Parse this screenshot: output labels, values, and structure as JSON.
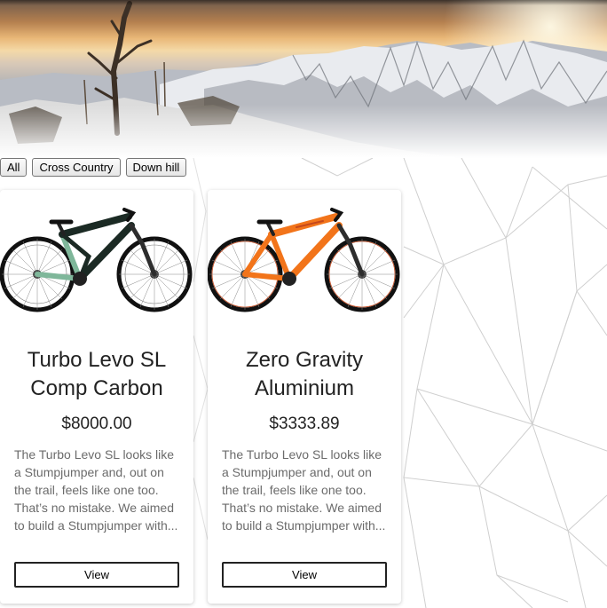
{
  "filters": [
    {
      "label": "All"
    },
    {
      "label": "Cross Country"
    },
    {
      "label": "Down hill"
    }
  ],
  "products": [
    {
      "title": "Turbo Levo SL Comp Carbon",
      "price": "$8000.00",
      "description": "The Turbo Levo SL looks like a Stumpjumper and, out on the trail, feels like one too. That’s no mistake. We aimed to build a Stumpjumper with...",
      "view_label": "View",
      "frame_color": "#1b2a24",
      "accent_color": "#7fb79a"
    },
    {
      "title": "Zero Gravity Aluminium",
      "price": "$3333.89",
      "description": "The Turbo Levo SL looks like a Stumpjumper and, out on the trail, feels like one too. That’s no mistake. We aimed to build a Stumpjumper with...",
      "view_label": "View",
      "frame_color": "#f2741a",
      "accent_color": "#c4471b"
    }
  ]
}
